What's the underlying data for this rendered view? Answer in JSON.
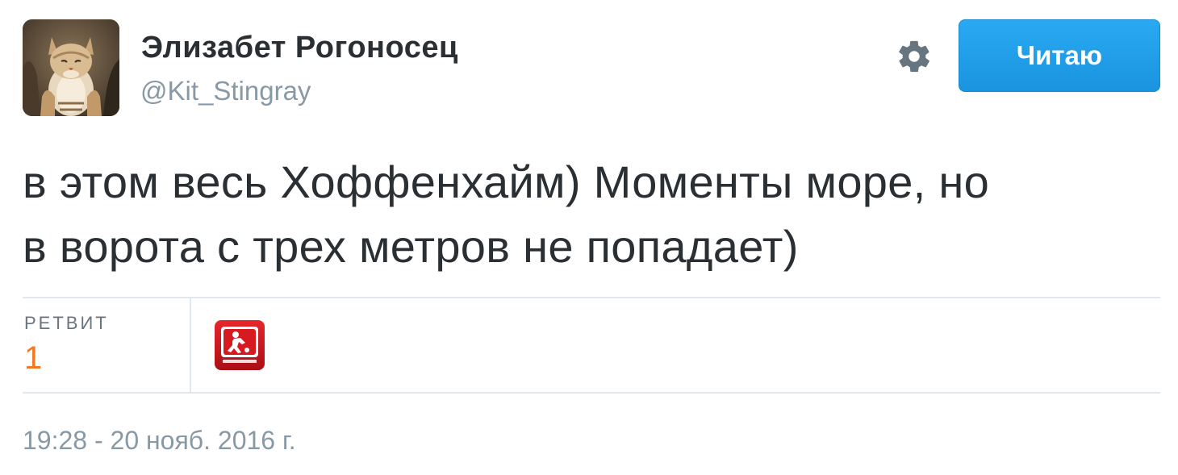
{
  "user": {
    "display_name": "Элизабет Рогоносец",
    "handle": "@Kit_Stingray",
    "avatar_icon": "cat-photo-avatar"
  },
  "header": {
    "settings_icon": "gear-icon",
    "follow_label": "Читаю"
  },
  "tweet": {
    "lines": [
      "в этом весь Хоффенхайм) Моменты море, но",
      "в ворота с трех метров не попадает)"
    ]
  },
  "stats": {
    "retweets_label": "РЕТВИТ",
    "retweets_count": "1",
    "retweeter_icon": "bundesliga-logo-avatar"
  },
  "meta": {
    "timestamp": "19:28 - 20 нояб. 2016 г."
  },
  "colors": {
    "accent": "#1da1f2",
    "count": "#f5781e",
    "muted": "#8899a6",
    "text": "#292f33",
    "divider": "#e1e8ed"
  }
}
